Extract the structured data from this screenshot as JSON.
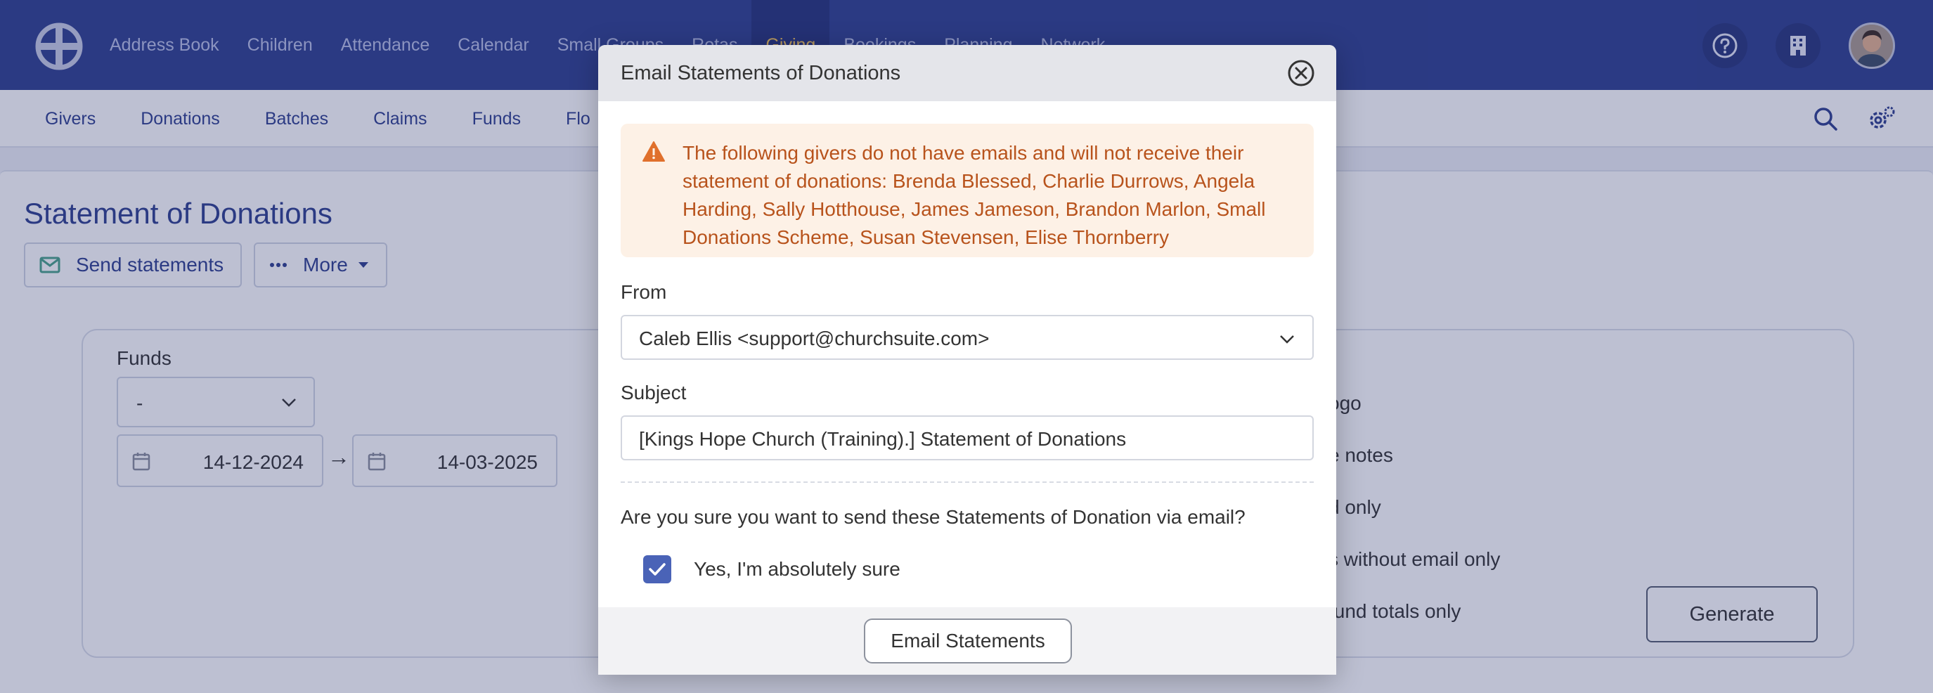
{
  "topnav": {
    "items": [
      {
        "label": "Address Book"
      },
      {
        "label": "Children"
      },
      {
        "label": "Attendance"
      },
      {
        "label": "Calendar"
      },
      {
        "label": "Small Groups"
      },
      {
        "label": "Rotas"
      },
      {
        "label": "Giving"
      },
      {
        "label": "Bookings"
      },
      {
        "label": "Planning"
      },
      {
        "label": "Network"
      }
    ],
    "active": "Giving",
    "icons": [
      "help-icon",
      "building-icon"
    ],
    "colors": {
      "background": "#2e3f8f",
      "active_text": "#f2c35a"
    }
  },
  "subnav": {
    "items": [
      {
        "label": "Givers"
      },
      {
        "label": "Donations"
      },
      {
        "label": "Batches"
      },
      {
        "label": "Claims"
      },
      {
        "label": "Funds"
      },
      {
        "label": "Flo"
      }
    ],
    "icons": [
      "search-icon",
      "settings-icon"
    ]
  },
  "page": {
    "title": "Statement of Donations",
    "send_label": "Send statements",
    "more_label": "More",
    "funds_label": "Funds",
    "funds_value": "-",
    "date_from": "14-12-2024",
    "date_arrow": "→",
    "date_to": "14-03-2025",
    "options": [
      "ogo",
      "e notes",
      "d only",
      "s without email only",
      "fund totals only"
    ],
    "generate_label": "Generate"
  },
  "modal": {
    "title": "Email Statements of Donations",
    "warning": "The following givers do not have emails and will not receive their statement of donations: Brenda Blessed, Charlie Durrows, Angela Harding, Sally Hotthouse, James Jameson, Brandon Marlon, Small Donations Scheme, Susan Stevensen, Elise Thornberry",
    "from_label": "From",
    "from_value": "Caleb Ellis <support@churchsuite.com>",
    "subject_label": "Subject",
    "subject_value": "[Kings Hope Church (Training).] Statement of Donations",
    "confirm_question": "Are you sure you want to send these Statements of Donation via email?",
    "confirm_label": "Yes, I'm absolutely sure",
    "confirm_checked": true,
    "submit_label": "Email Statements",
    "colors": {
      "warning_bg": "#fdf1e6",
      "warning_text": "#b8531c",
      "checkbox": "#4a63b7"
    }
  }
}
